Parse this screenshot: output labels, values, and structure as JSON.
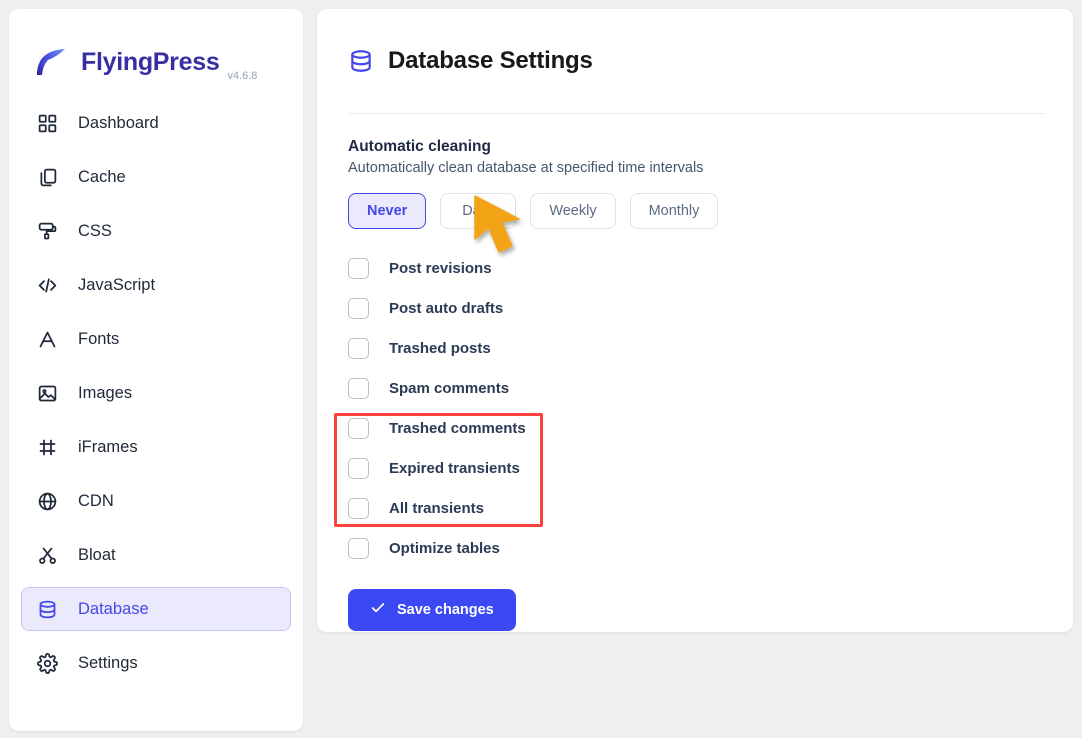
{
  "app": {
    "brand_name": "FlyingPress",
    "version": "v4.6.8",
    "logo_icon": "feather-swoosh-icon"
  },
  "sidebar": {
    "items": [
      {
        "label": "Dashboard",
        "icon": "grid-icon",
        "active": false
      },
      {
        "label": "Cache",
        "icon": "copy-icon",
        "active": false
      },
      {
        "label": "CSS",
        "icon": "paint-roller-icon",
        "active": false
      },
      {
        "label": "JavaScript",
        "icon": "code-brackets-icon",
        "active": false
      },
      {
        "label": "Fonts",
        "icon": "letter-a-icon",
        "active": false
      },
      {
        "label": "Images",
        "icon": "image-icon",
        "active": false
      },
      {
        "label": "iFrames",
        "icon": "frame-icon",
        "active": false
      },
      {
        "label": "CDN",
        "icon": "globe-icon",
        "active": false
      },
      {
        "label": "Bloat",
        "icon": "scissors-icon",
        "active": false
      },
      {
        "label": "Database",
        "icon": "database-icon",
        "active": true
      },
      {
        "label": "Settings",
        "icon": "gear-icon",
        "active": false
      }
    ]
  },
  "main": {
    "page_title": "Database Settings",
    "page_icon": "database-icon",
    "section": {
      "title": "Automatic cleaning",
      "description": "Automatically clean database at specified time intervals"
    },
    "intervals": {
      "selected": "Never",
      "options": [
        {
          "label": "Never",
          "selected": true
        },
        {
          "label": "Daily",
          "selected": false
        },
        {
          "label": "Weekly",
          "selected": false
        },
        {
          "label": "Monthly",
          "selected": false
        }
      ]
    },
    "cleanup_options": [
      {
        "label": "Post revisions",
        "checked": false
      },
      {
        "label": "Post auto drafts",
        "checked": false
      },
      {
        "label": "Trashed posts",
        "checked": false
      },
      {
        "label": "Spam comments",
        "checked": false
      },
      {
        "label": "Trashed comments",
        "checked": false
      },
      {
        "label": "Expired transients",
        "checked": false
      },
      {
        "label": "All transients",
        "checked": false
      },
      {
        "label": "Optimize tables",
        "checked": false
      }
    ],
    "save_button": {
      "label": "Save changes",
      "icon": "check-icon"
    }
  },
  "annotations": {
    "highlight_box": {
      "shape": "rectangle",
      "color": "#f8423b",
      "targets": [
        "Expired transients",
        "All transients",
        "Optimize tables"
      ]
    },
    "cursor": {
      "shape": "arrow-pointer",
      "color": "#f2a318",
      "points_at": "Daily"
    }
  },
  "colors": {
    "accent": "#4547e8",
    "primary_button": "#3b49f5",
    "brand_text": "#3730a3",
    "active_nav_bg": "#eaeafc",
    "annotation_red": "#f8423b",
    "cursor_orange": "#f2a318",
    "page_bg": "#efefef",
    "card_bg": "#ffffff"
  }
}
